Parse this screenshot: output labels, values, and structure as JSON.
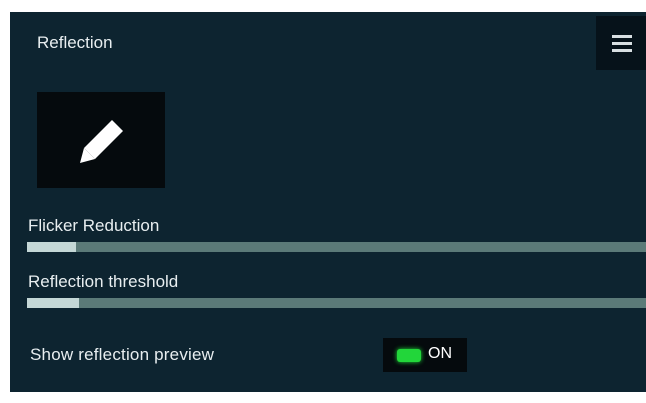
{
  "panel": {
    "title": "Reflection",
    "menu_icon": "hamburger-menu-icon",
    "edit_icon": "pencil-icon",
    "colors": {
      "background": "#0d2430",
      "track": "#5b7a78",
      "fill": "#c4d7d6",
      "toggle_on": "#22d63a"
    }
  },
  "sliders": [
    {
      "label": "Flicker Reduction",
      "value_fraction": 0.08
    },
    {
      "label": "Reflection threshold",
      "value_fraction": 0.085
    }
  ],
  "preview_toggle": {
    "label": "Show reflection preview",
    "state_text": "ON",
    "on": true
  }
}
